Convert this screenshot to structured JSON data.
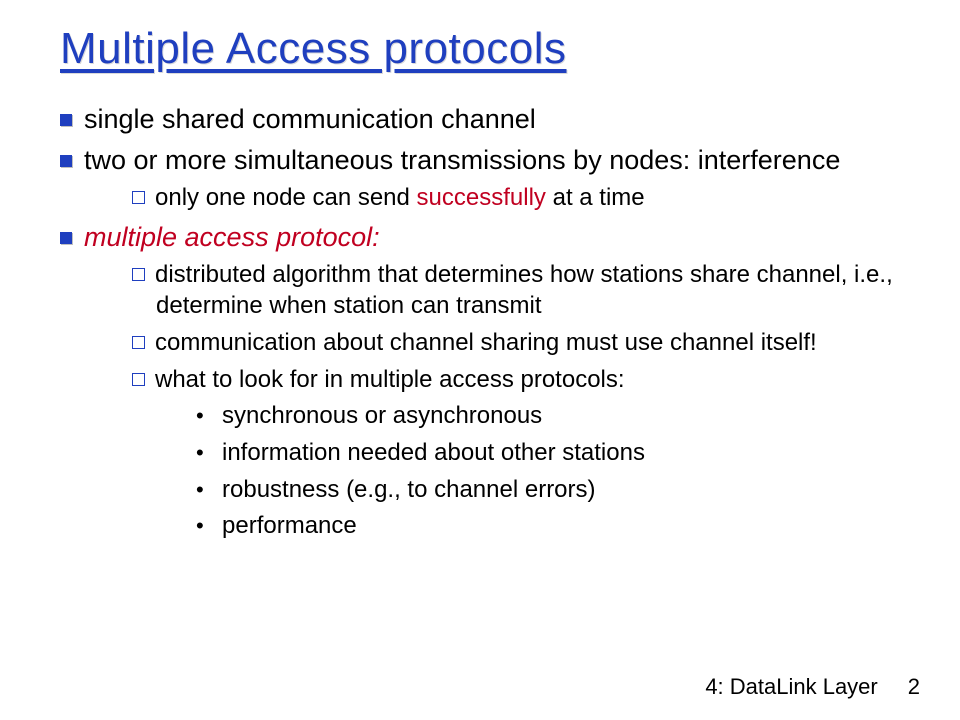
{
  "title": "Multiple Access protocols",
  "bullets": {
    "b1": "single shared communication channel",
    "b2": "two or more simultaneous transmissions by nodes: interference",
    "b2_1_pre": "only one node can send ",
    "b2_1_em": "successfully",
    "b2_1_post": " at a time",
    "b3": "multiple access protocol:",
    "b3_1": "distributed algorithm that determines how stations share channel, i.e., determine when station can transmit",
    "b3_2": "communication about channel sharing must use channel itself!",
    "b3_3": "what to look for in multiple access protocols:",
    "b3_3_1": "synchronous or asynchronous",
    "b3_3_2": "information needed about other stations",
    "b3_3_3": "robustness (e.g., to channel errors)",
    "b3_3_4": "performance"
  },
  "footer": {
    "label": "4: DataLink Layer",
    "page": "2"
  }
}
